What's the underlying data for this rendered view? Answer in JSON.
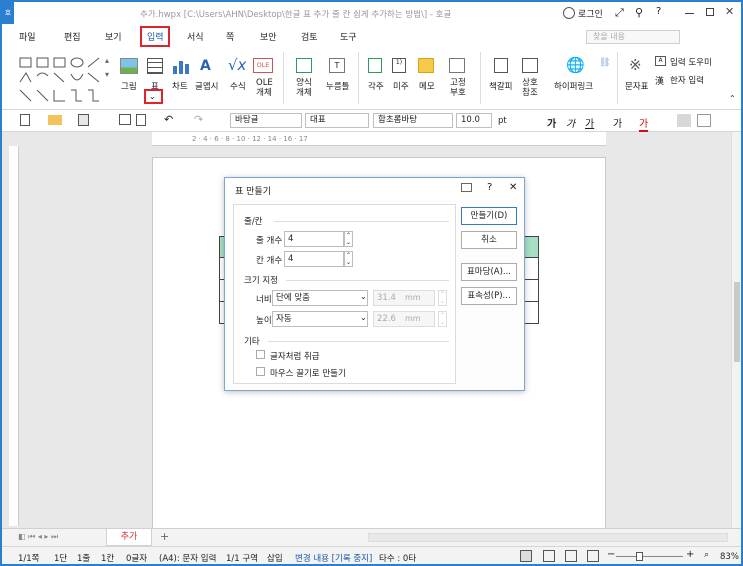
{
  "window": {
    "title": "추가.hwpx [C:\\Users\\AHN\\Desktop\\한글 표 추가 줄 칸 쉽게 추가하는 방법\\] - 호글",
    "login_label": "로그인",
    "help_label": "?"
  },
  "menu": {
    "items": [
      "파일",
      "편집",
      "보기",
      "입력",
      "서식",
      "쪽",
      "보안",
      "검토",
      "도구"
    ],
    "search_placeholder": "찾을 내용"
  },
  "ribbon": {
    "labels": {
      "picture": "그림",
      "table": "표",
      "chart": "차트",
      "graph": "글맵시",
      "formula": "수식",
      "ole": "OLE 개체",
      "form_object": "양식 개체",
      "button_obj": "누름틀",
      "each_char": "각주",
      "endnote": "미주",
      "memo": "메모",
      "fixed": "고정 부호",
      "bookmark": "책갈피",
      "cross_ref": "상호 참조",
      "hyperlink": "하이퍼링크",
      "char_table": "문자표",
      "input_helper": "입력 도우미",
      "hanja_input": "한자 입력"
    }
  },
  "toolbar": {
    "style": "바탕글",
    "para": "대표",
    "font": "함초롬바탕",
    "size": "10.0",
    "unit": "pt",
    "ruler": "2 · 4 · 6 · 8 · 10 · 12 · 14 · 16 · 17"
  },
  "dialog": {
    "title": "표 만들기",
    "section_rows_cols": "줄/칸",
    "rows_label": "줄 개수",
    "rows_value": "4",
    "cols_label": "칸 개수",
    "cols_value": "4",
    "section_size": "크기 지정",
    "width_label": "너비",
    "width_select": "단에 맞춤",
    "width_value": "31.4",
    "width_unit": "mm",
    "height_label": "높이",
    "height_select": "자동",
    "height_value": "22.6",
    "height_unit": "mm",
    "section_etc": "기타",
    "opt_treat_as_char": "글자처럼 취급",
    "opt_mouse_drag": "마우스 끌기로 만들기",
    "btn_create": "만들기(D)",
    "btn_cancel": "취소",
    "btn_table_style": "표마당(A)...",
    "btn_properties": "표속성(P)..."
  },
  "tabs": {
    "doc_tab": "추가",
    "add": "+"
  },
  "status": {
    "page": "1/1쪽",
    "section": "1단",
    "line": "1줄",
    "col": "1칸",
    "chars": "0글자",
    "mode": "(A4): 문자 입력",
    "zone": "1/1 구역",
    "insert": "삽입",
    "change": "변경 내용 [기록 중지]",
    "typing": "타수 : 0타",
    "zoom": "83%"
  },
  "colors": {
    "accent": "#2b7fd0",
    "highlight": "#e0242a",
    "table_header": "#a8e0c6"
  }
}
